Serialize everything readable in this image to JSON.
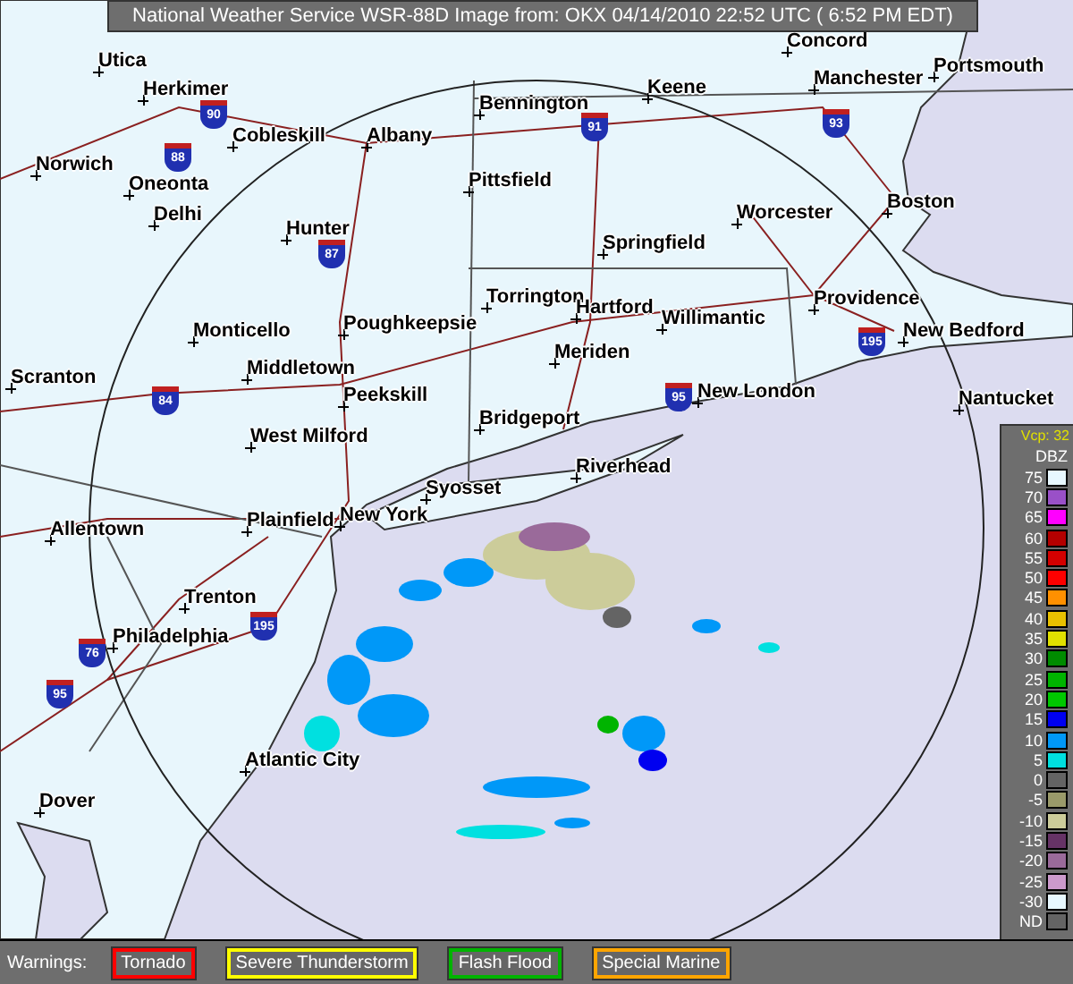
{
  "title_bar": {
    "text": "National Weather Service WSR-88D Image from: OKX 04/14/2010 22:52 UTC ( 6:52 PM EDT)"
  },
  "map": {
    "cities": [
      {
        "name": "Concord"
      },
      {
        "name": "Utica"
      },
      {
        "name": "Herkimer"
      },
      {
        "name": "Portsmouth"
      },
      {
        "name": "Manchester"
      },
      {
        "name": "Keene"
      },
      {
        "name": "Bennington"
      },
      {
        "name": "Cobleskill"
      },
      {
        "name": "Albany"
      },
      {
        "name": "Norwich"
      },
      {
        "name": "Oneonta"
      },
      {
        "name": "Pittsfield"
      },
      {
        "name": "Delhi"
      },
      {
        "name": "Hunter"
      },
      {
        "name": "Worcester"
      },
      {
        "name": "Boston"
      },
      {
        "name": "Springfield"
      },
      {
        "name": "Torrington"
      },
      {
        "name": "Hartford"
      },
      {
        "name": "Providence"
      },
      {
        "name": "Willimantic"
      },
      {
        "name": "Monticello"
      },
      {
        "name": "Poughkeepsie"
      },
      {
        "name": "New Bedford"
      },
      {
        "name": "Middletown"
      },
      {
        "name": "Meriden"
      },
      {
        "name": "Scranton"
      },
      {
        "name": "Peekskill"
      },
      {
        "name": "New London"
      },
      {
        "name": "Nantucket"
      },
      {
        "name": "Bridgeport"
      },
      {
        "name": "West Milford"
      },
      {
        "name": "Riverhead"
      },
      {
        "name": "Syosset"
      },
      {
        "name": "New York"
      },
      {
        "name": "Plainfield"
      },
      {
        "name": "Allentown"
      },
      {
        "name": "Trenton"
      },
      {
        "name": "Philadelphia"
      },
      {
        "name": "Atlantic City"
      },
      {
        "name": "Dover"
      }
    ],
    "interstates": [
      {
        "number": "90"
      },
      {
        "number": "88"
      },
      {
        "number": "87"
      },
      {
        "number": "91"
      },
      {
        "number": "93"
      },
      {
        "number": "84"
      },
      {
        "number": "95"
      },
      {
        "number": "195"
      },
      {
        "number": "195"
      },
      {
        "number": "76"
      },
      {
        "number": "95"
      }
    ]
  },
  "legend": {
    "vcp": "Vcp: 32",
    "unit": "DBZ",
    "entries": [
      {
        "label": "75",
        "color": "#e8f8ff"
      },
      {
        "label": "70",
        "color": "#9a50c8"
      },
      {
        "label": "65",
        "color": "#ff00ff"
      },
      {
        "label": "60",
        "color": "#b40000"
      },
      {
        "label": "55",
        "color": "#d40000"
      },
      {
        "label": "50",
        "color": "#ff0000"
      },
      {
        "label": "45",
        "color": "#ff9000"
      },
      {
        "label": "40",
        "color": "#e8c000"
      },
      {
        "label": "35",
        "color": "#e0e000"
      },
      {
        "label": "30",
        "color": "#008c00"
      },
      {
        "label": "25",
        "color": "#00b400"
      },
      {
        "label": "20",
        "color": "#00c800"
      },
      {
        "label": "15",
        "color": "#0000f0"
      },
      {
        "label": "10",
        "color": "#0098f8"
      },
      {
        "label": "5",
        "color": "#00e0e0"
      },
      {
        "label": "0",
        "color": "#646464"
      },
      {
        "label": "-5",
        "color": "#9a9a6a"
      },
      {
        "label": "-10",
        "color": "#cccc9a"
      },
      {
        "label": "-15",
        "color": "#663366"
      },
      {
        "label": "-20",
        "color": "#9a6a9a"
      },
      {
        "label": "-25",
        "color": "#cc9acc"
      },
      {
        "label": "-30",
        "color": "#e8f8ff"
      },
      {
        "label": "ND",
        "color": "#646464"
      }
    ]
  },
  "warnings": {
    "label": "Warnings:",
    "items": [
      {
        "label": "Tornado",
        "color": "#ff0000"
      },
      {
        "label": "Severe Thunderstorm",
        "color": "#ffff00"
      },
      {
        "label": "Flash Flood",
        "color": "#00b400"
      },
      {
        "label": "Special Marine",
        "color": "#ffa500"
      }
    ]
  }
}
